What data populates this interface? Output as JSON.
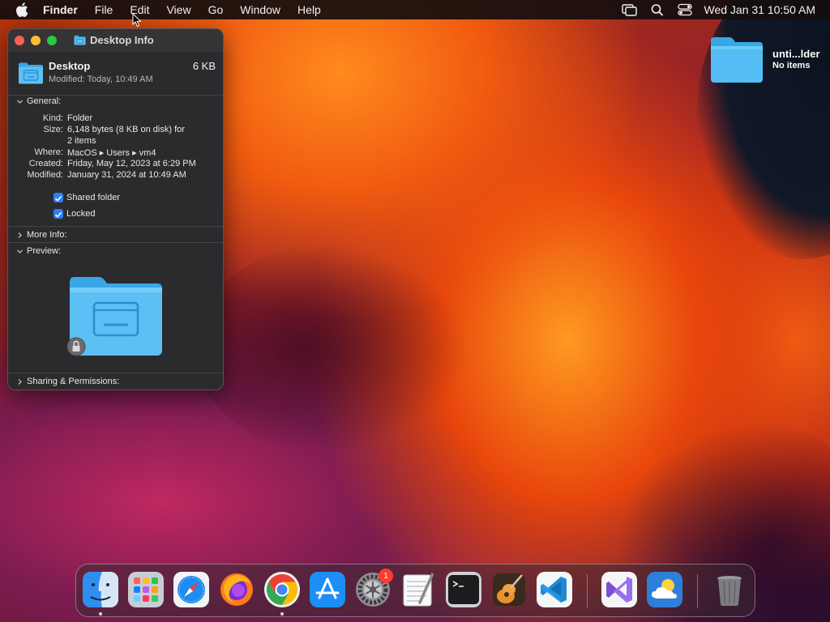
{
  "menubar": {
    "app_name": "Finder",
    "items": [
      "File",
      "Edit",
      "View",
      "Go",
      "Window",
      "Help"
    ],
    "clock": "Wed Jan 31  10:50 AM",
    "status_icons": [
      "screen-mirroring-icon",
      "spotlight-search-icon",
      "control-center-icon"
    ]
  },
  "desktop": {
    "folder_name": "unti...lder",
    "folder_subtitle": "No items"
  },
  "info_window": {
    "title": "Desktop Info",
    "name": "Desktop",
    "size": "6 KB",
    "modified_line": "Modified: Today, 10:49 AM",
    "general": {
      "header": "General:",
      "rows": [
        {
          "label": "Kind:",
          "value": "Folder"
        },
        {
          "label": "Size:",
          "value": "6,148 bytes (8 KB on disk) for"
        },
        {
          "label": "",
          "value": "2 items"
        },
        {
          "label": "Where:",
          "value": "MacOS ▸ Users ▸ vm4"
        },
        {
          "label": "Created:",
          "value": "Friday, May 12, 2023 at 6:29 PM"
        },
        {
          "label": "Modified:",
          "value": "January 31, 2024 at 10:49 AM"
        }
      ],
      "shared_folder_label": "Shared folder",
      "shared_folder_checked": true,
      "locked_label": "Locked",
      "locked_checked": true
    },
    "more_info_header": "More Info:",
    "preview_header": "Preview:",
    "sharing_header": "Sharing & Permissions:"
  },
  "dock": {
    "apps": [
      "Finder",
      "Launchpad",
      "Safari",
      "Firefox",
      "Google Chrome",
      "App Store",
      "System Settings",
      "TextEdit",
      "Terminal",
      "GarageBand",
      "Visual Studio Code",
      "Visual Studio",
      "Weather",
      "Trash"
    ],
    "settings_badge": "1"
  },
  "colors": {
    "accent": "#2f7ef6",
    "window_bg": "#2b2b2d",
    "folder_blue": "#5ac8fa"
  }
}
